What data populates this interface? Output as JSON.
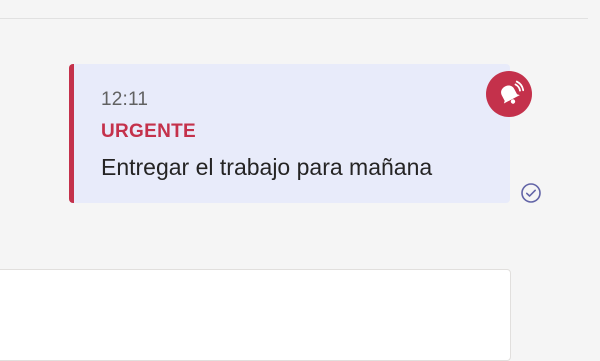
{
  "message": {
    "time": "12:11",
    "priority_label": "URGENTE",
    "text": "Entregar el trabajo para mañana"
  },
  "icons": {
    "priority": "urgent-bell-icon",
    "status": "read-check-icon"
  },
  "colors": {
    "urgent": "#c4314b",
    "message_bg": "#e8ebfa",
    "read_check": "#6264a7",
    "page_bg": "#f5f5f5"
  }
}
